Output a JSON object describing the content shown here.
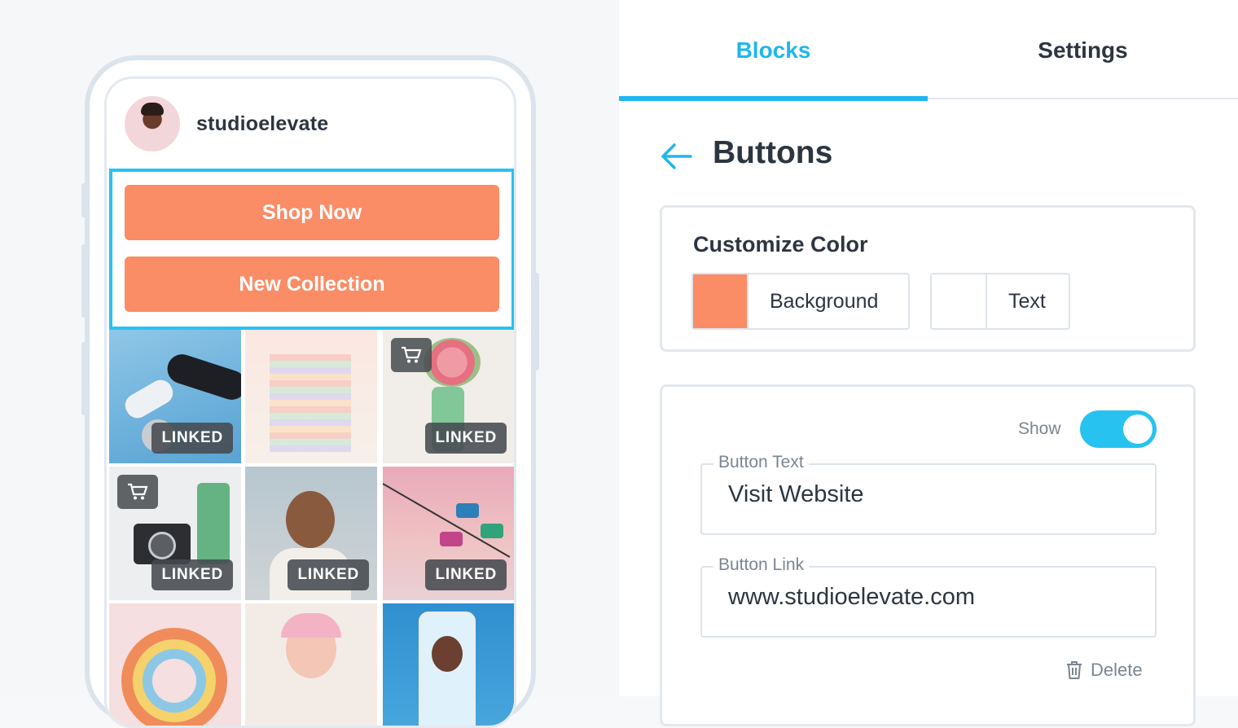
{
  "preview": {
    "username": "studioelevate",
    "buttons": [
      "Shop Now",
      "New Collection"
    ],
    "linked_label": "LINKED",
    "button_color": "#fa8c66",
    "highlight_color": "#28c2f1"
  },
  "tabs": [
    {
      "label": "Blocks",
      "active": true
    },
    {
      "label": "Settings",
      "active": false
    }
  ],
  "editor": {
    "title": "Buttons",
    "customize_color": {
      "heading": "Customize Color",
      "background_label": "Background",
      "background_color": "#fa8c66",
      "text_label": "Text",
      "text_color": "#ffffff"
    },
    "button_item": {
      "show_label": "Show",
      "show_enabled": true,
      "button_text_label": "Button Text",
      "button_text_value": "Visit Website",
      "button_link_label": "Button Link",
      "button_link_value": "www.studioelevate.com",
      "delete_label": "Delete"
    }
  },
  "icons": {
    "back": "arrow-left-icon",
    "cart": "cart-icon",
    "delete": "trash-icon"
  },
  "accent_color": "#1fb6ef"
}
